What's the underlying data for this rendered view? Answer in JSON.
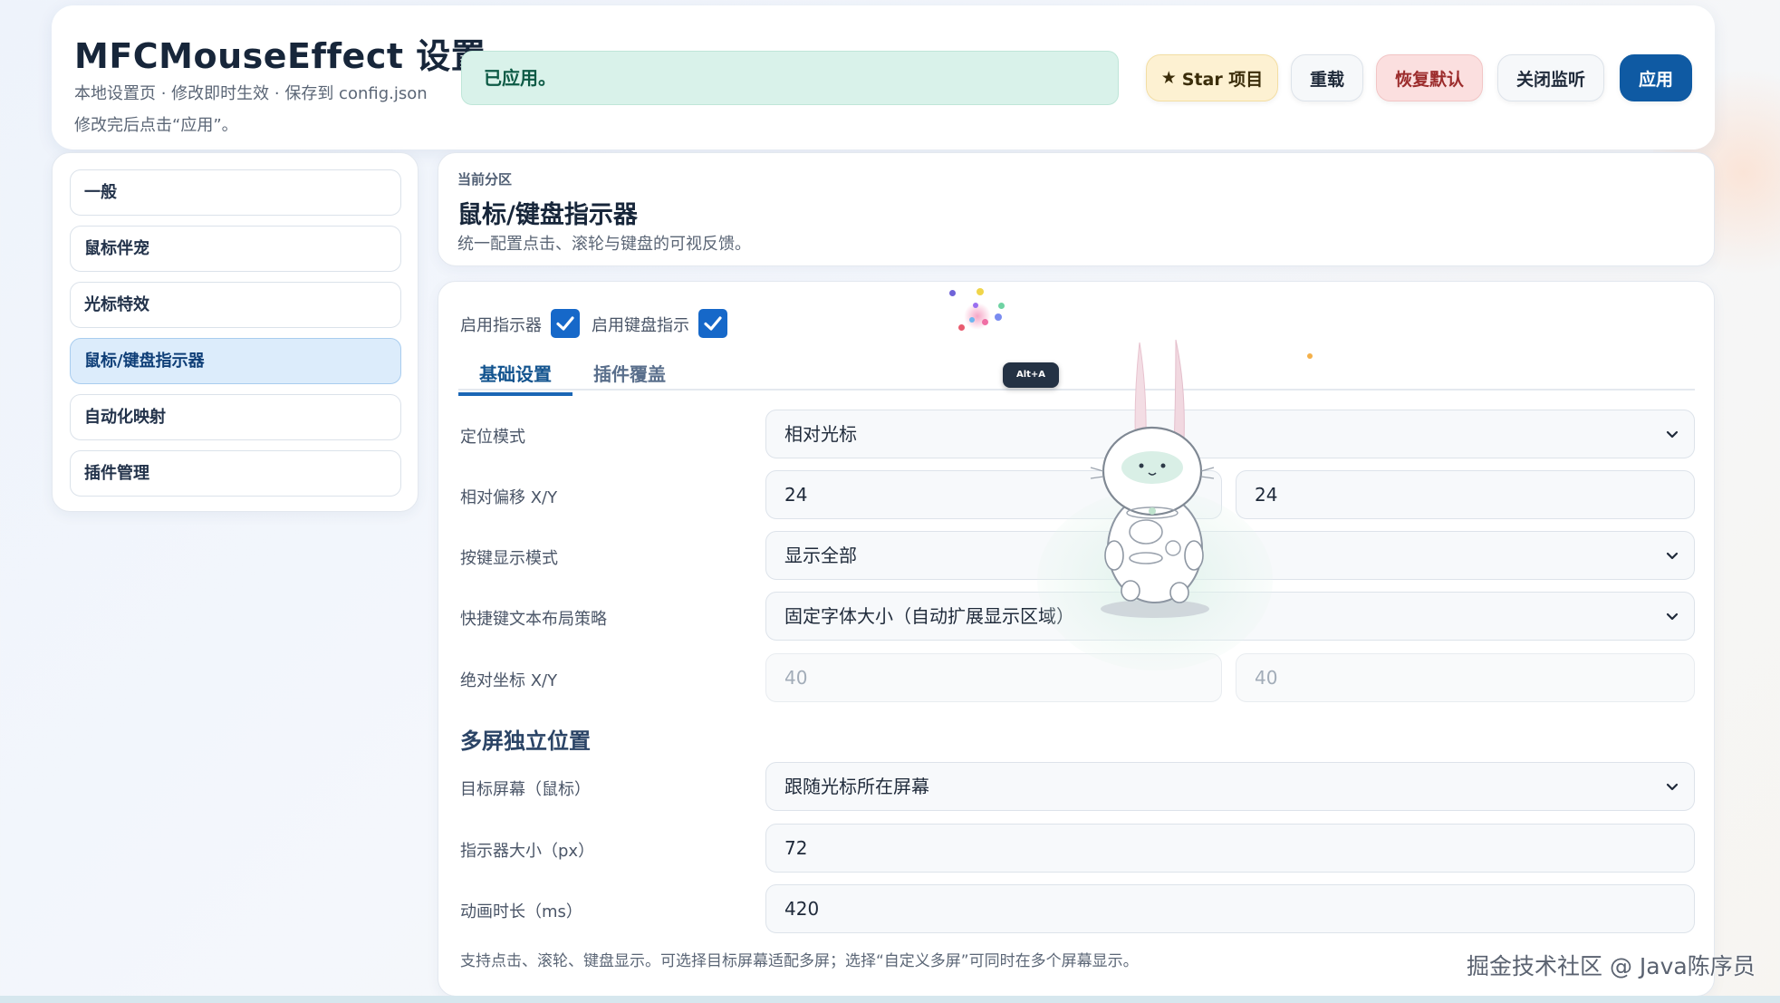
{
  "header": {
    "title": "MFCMouseEffect 设置",
    "subtitle": "本地设置页 · 修改即时生效 · 保存到 config.json",
    "hint": "修改完后点击“应用”。",
    "status": "已应用。",
    "buttons": {
      "star": "Star 项目",
      "reload": "重载",
      "reset": "恢复默认",
      "close_monitor": "关闭监听",
      "apply": "应用"
    }
  },
  "sidebar": {
    "items": [
      {
        "label": "一般",
        "active": false
      },
      {
        "label": "鼠标伴宠",
        "active": false
      },
      {
        "label": "光标特效",
        "active": false
      },
      {
        "label": "鼠标/键盘指示器",
        "active": true
      },
      {
        "label": "自动化映射",
        "active": false
      },
      {
        "label": "插件管理",
        "active": false
      }
    ]
  },
  "section": {
    "kicker": "当前分区",
    "title": "鼠标/键盘指示器",
    "description": "统一配置点击、滚轮与键盘的可视反馈。"
  },
  "toggles": {
    "indicator": {
      "label": "启用指示器",
      "checked": true
    },
    "keyboard": {
      "label": "启用键盘指示",
      "checked": true
    }
  },
  "tabs": [
    {
      "label": "基础设置",
      "active": true
    },
    {
      "label": "插件覆盖",
      "active": false
    }
  ],
  "form": {
    "position_mode": {
      "label": "定位模式",
      "value": "相对光标"
    },
    "relative_offset": {
      "label": "相对偏移 X/Y",
      "x": "24",
      "y": "24"
    },
    "key_display_mode": {
      "label": "按键显示模式",
      "value": "显示全部"
    },
    "shortcut_layout": {
      "label": "快捷键文本布局策略",
      "value": "固定字体大小（自动扩展显示区域）"
    },
    "absolute_coords": {
      "label": "绝对坐标 X/Y",
      "x": "40",
      "y": "40"
    },
    "multiscreen_heading": "多屏独立位置",
    "target_screen": {
      "label": "目标屏幕（鼠标）",
      "value": "跟随光标所在屏幕"
    },
    "indicator_size": {
      "label": "指示器大小（px）",
      "value": "72"
    },
    "animation_duration": {
      "label": "动画时长（ms）",
      "value": "420"
    },
    "footer_note": "支持点击、滚轮、键盘显示。可选择目标屏幕适配多屏；选择“自定义多屏”可同时在多个屏幕显示。"
  },
  "overlay": {
    "key_chip": "Alt+A"
  },
  "watermark": "掘金技术社区 @ Java陈序员",
  "colors": {
    "accent": "#0f5aa3",
    "status_bg": "#d9f2ea",
    "active_nav_bg": "#dcecfb",
    "reset_bg": "#fbdfdf",
    "star_bg": "#fdf1d2"
  }
}
